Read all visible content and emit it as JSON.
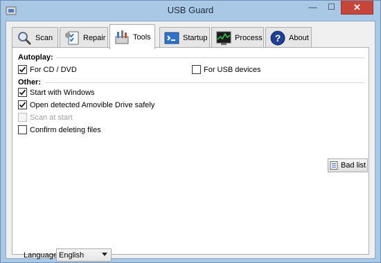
{
  "window": {
    "title": "USB Guard",
    "close_glyph": "✕",
    "minimize_glyph": "—",
    "maximize_glyph": "☐"
  },
  "tabs": [
    {
      "label": "Scan",
      "icon": "scan-icon"
    },
    {
      "label": "Repair",
      "icon": "repair-icon"
    },
    {
      "label": "Tools",
      "icon": "tools-icon",
      "active": true
    },
    {
      "label": "Startup",
      "icon": "startup-icon"
    },
    {
      "label": "Process",
      "icon": "process-icon"
    },
    {
      "label": "About",
      "icon": "about-icon"
    }
  ],
  "autoplay": {
    "heading": "Autoplay:",
    "cd_dvd": {
      "label": "For CD / DVD",
      "checked": true
    },
    "usb": {
      "label": "For USB devices",
      "checked": false
    }
  },
  "other": {
    "heading": "Other:",
    "start_windows": {
      "label": "Start with Windows",
      "checked": true
    },
    "open_amovible": {
      "label": "Open detected Amovible Drive safely",
      "checked": true
    },
    "scan_start": {
      "label": "Scan at start",
      "checked": false,
      "disabled": true
    },
    "confirm_delete": {
      "label": "Confirm deleting files",
      "checked": false
    }
  },
  "bad_list_button": {
    "label": "Bad list",
    "icon": "list-icon"
  },
  "language": {
    "label": "Language:",
    "value": "English"
  },
  "colors": {
    "accent": "#c7463c",
    "frame": "#a9c8e6",
    "check": "#1a1a1a"
  }
}
